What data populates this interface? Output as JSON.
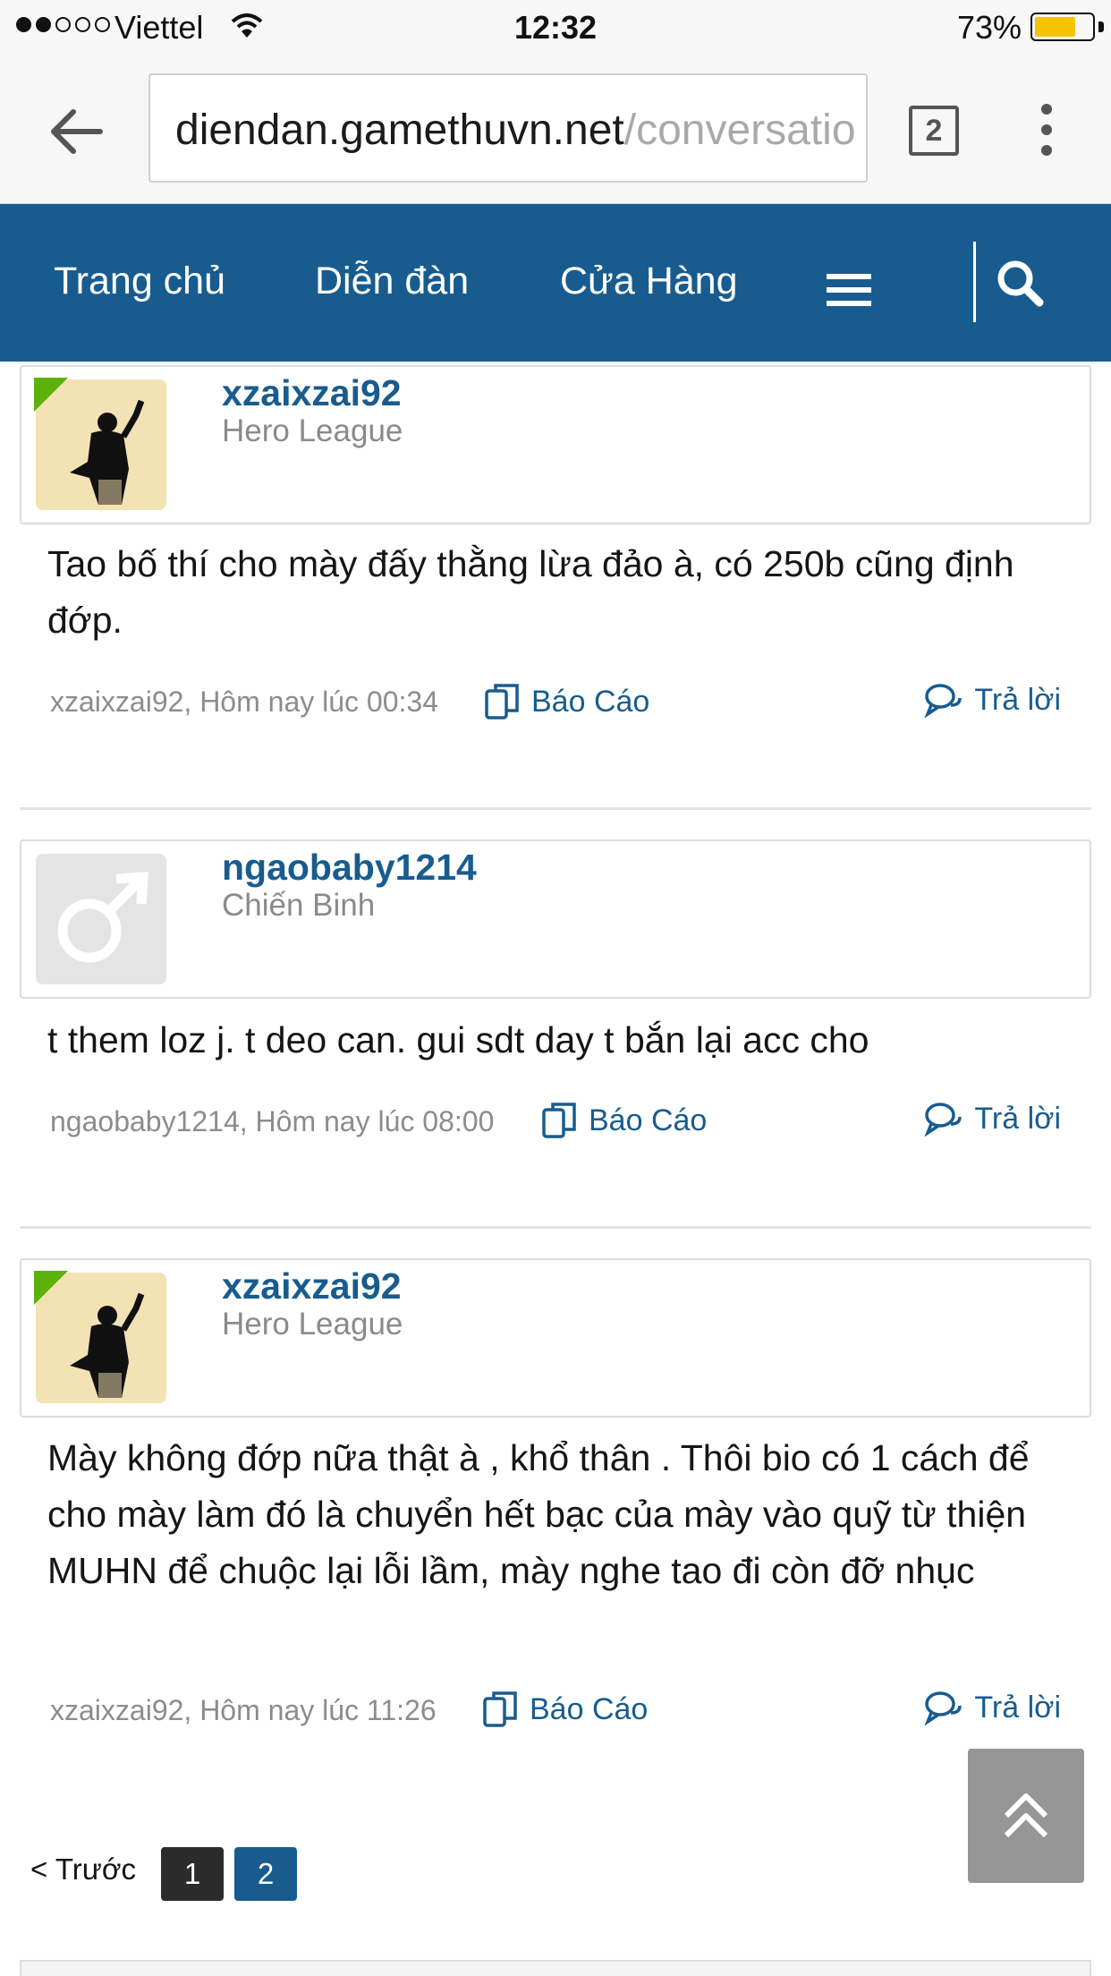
{
  "status_bar": {
    "carrier": "Viettel",
    "time": "12:32",
    "battery_percent": "73%",
    "battery_level": 0.73,
    "battery_color": "#f5c400",
    "signal_bars": 2
  },
  "browser": {
    "url_host": "diendan.gamethuvn.net",
    "url_path": "/conversatio",
    "tab_count": "2"
  },
  "nav": {
    "background": "#185c8f",
    "items": [
      "Trang chủ",
      "Diễn đàn",
      "Cửa Hàng"
    ],
    "menu_icon": "hamburger-icon",
    "search_icon": "search-icon"
  },
  "messages": [
    {
      "username": "xzaixzai92",
      "user_title": "Hero League",
      "online": true,
      "avatar": "photo",
      "body": "Tao bố thí cho mày đấy thằng lừa đảo à, có 250b cũng định đớp.",
      "meta": "xzaixzai92, Hôm nay lúc 00:34",
      "report_label": "Báo Cáo",
      "reply_label": "Trả lời"
    },
    {
      "username": "ngaobaby1214",
      "user_title": "Chiến Binh",
      "online": false,
      "avatar": "default-male",
      "body": "t them loz j. t deo can. gui sdt day t bắn lại acc cho",
      "meta": "ngaobaby1214, Hôm nay lúc 08:00",
      "report_label": "Báo Cáo",
      "reply_label": "Trả lời"
    },
    {
      "username": "xzaixzai92",
      "user_title": "Hero League",
      "online": true,
      "avatar": "photo",
      "body": "Mày không đớp nữa thật à , khổ thân . Thôi bio có 1 cách để cho mày làm đó là chuyển hết bạc của mày vào quỹ từ thiện MUHN để chuộc lại lỗi lầm, mày nghe tao đi còn đỡ nhục",
      "meta": "xzaixzai92, Hôm nay lúc 11:26",
      "report_label": "Báo Cáo",
      "reply_label": "Trả lời"
    }
  ],
  "pagination": {
    "prev_label": "< Trước",
    "pages": [
      "1",
      "2"
    ],
    "current": "2"
  },
  "back_to_top_icon": "double-chevron-up-icon"
}
